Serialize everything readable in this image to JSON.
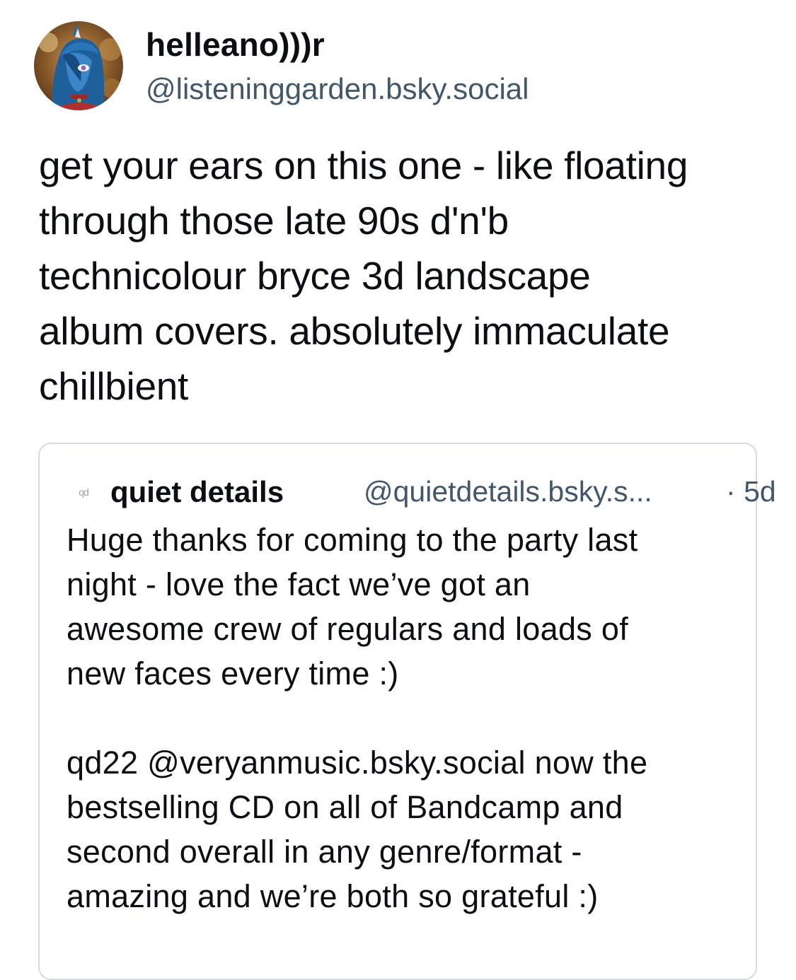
{
  "post": {
    "author": {
      "display_name": "helleano)))r",
      "handle": "@listeninggarden.bsky.social"
    },
    "text": "get your ears on this one - like floating\nthrough those late 90s d'n'b\ntechnicolour bryce 3d landscape\nalbum covers. absolutely immaculate\nchillbient"
  },
  "quote": {
    "avatar_text": "qd",
    "display_name": "quiet details",
    "handle": "@quietdetails.bsky.s...",
    "separator": "·",
    "timestamp": "5d",
    "text": "Huge thanks for coming to the party last\nnight - love the fact we’ve got an\nawesome crew of regulars and loads of\nnew faces every time :)\n\nqd22 @veryanmusic.bsky.social now the\nbestselling CD on all of Bandcamp and\nsecond overall in any genre/format -\namazing and we’re both so grateful :)"
  },
  "colors": {
    "text_primary": "#0b0f14",
    "text_secondary": "#42576c",
    "card_border": "#d4dbe2"
  }
}
